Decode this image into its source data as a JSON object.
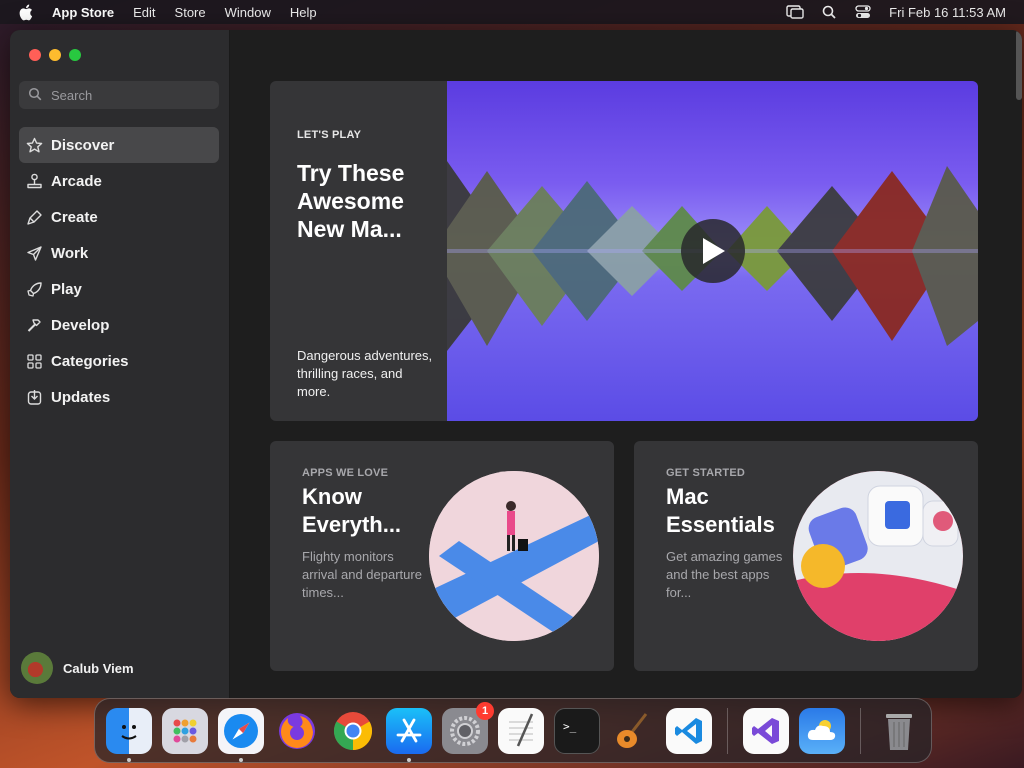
{
  "menubar": {
    "app_name": "App Store",
    "items": [
      "Edit",
      "Store",
      "Window",
      "Help"
    ],
    "clock": "Fri Feb 16  11:53 AM"
  },
  "sidebar": {
    "search_placeholder": "Search",
    "items": [
      {
        "label": "Discover",
        "icon": "star-icon",
        "active": true
      },
      {
        "label": "Arcade",
        "icon": "joystick-icon"
      },
      {
        "label": "Create",
        "icon": "paintbrush-icon"
      },
      {
        "label": "Work",
        "icon": "paperplane-icon"
      },
      {
        "label": "Play",
        "icon": "rocket-icon"
      },
      {
        "label": "Develop",
        "icon": "hammer-icon"
      },
      {
        "label": "Categories",
        "icon": "grid-icon"
      },
      {
        "label": "Updates",
        "icon": "download-icon"
      }
    ],
    "user_name": "Calub Viem"
  },
  "hero": {
    "eyebrow": "LET'S PLAY",
    "title": "Try These Awesome New Ma...",
    "description": "Dangerous adventures, thrilling races, and more."
  },
  "cards": [
    {
      "eyebrow": "APPS WE LOVE",
      "title": "Know Everyth...",
      "description": "Flighty monitors arrival and departure times..."
    },
    {
      "eyebrow": "GET STARTED",
      "title": "Mac Essentials",
      "description": "Get amazing games and the best apps for..."
    }
  ],
  "dock": {
    "apps": [
      "finder",
      "launchpad",
      "safari",
      "firefox",
      "chrome",
      "app-store",
      "system-settings",
      "textedit",
      "terminal",
      "garageband",
      "vscode",
      "visual-studio",
      "weather",
      "trash"
    ],
    "settings_badge": "1"
  },
  "colors": {
    "close": "#ff5f57",
    "minimize": "#febc2e",
    "zoom": "#28c840",
    "sidebar_bg": "#2c2c2e",
    "hero_purple": "#6b4ce6"
  }
}
